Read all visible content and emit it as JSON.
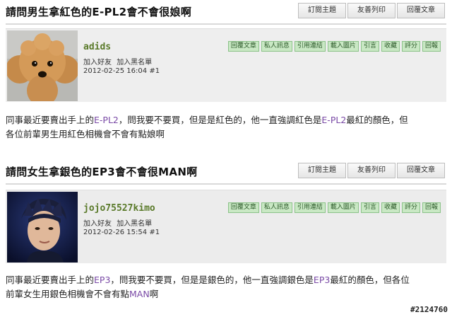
{
  "posts": [
    {
      "thread_title": "請問男生拿紅色的E-PL2會不會很娘啊",
      "toolbar": [
        "訂閱主題",
        "友善列印",
        "回覆文章"
      ],
      "user": {
        "name": "adids",
        "links": [
          "加入好友",
          "加入黑名單"
        ],
        "date": "2012-02-25 16:04",
        "floor": "#1"
      },
      "actions": [
        "回覆文章",
        "私人訊息",
        "引用連結",
        "載入圖片",
        "引言",
        "收藏",
        "評分",
        "回報"
      ],
      "body": [
        {
          "t": "同事最近要賣出手上的"
        },
        {
          "t": "E-PL2",
          "hl": true
        },
        {
          "t": "，問我要不要買，但是是紅色的，他一直強調紅色是"
        },
        {
          "t": "E-PL2",
          "hl": true
        },
        {
          "t": "最紅的顏色，但"
        },
        {
          "br": true
        },
        {
          "t": "各位前輩男生用紅色相機會不會有點娘啊"
        }
      ]
    },
    {
      "thread_title": "請問女生拿銀色的EP3會不會很MAN啊",
      "toolbar": [
        "訂閱主題",
        "友善列印",
        "回覆文章"
      ],
      "user": {
        "name": "jojo75527kimo",
        "links": [
          "加入好友",
          "加入黑名單"
        ],
        "date": "2012-02-26 15:54",
        "floor": "#1"
      },
      "actions": [
        "回覆文章",
        "私人訊息",
        "引用連結",
        "載入圖片",
        "引言",
        "收藏",
        "評分",
        "回報"
      ],
      "body": [
        {
          "t": "同事最近要賣出手上的"
        },
        {
          "t": "EP3",
          "hl": true
        },
        {
          "t": "，問我要不要買，但是是銀色的，他一直強調銀色是"
        },
        {
          "t": "EP3",
          "hl": true
        },
        {
          "t": "最紅的顏色，但各位"
        },
        {
          "br": true
        },
        {
          "t": "前輩女生用銀色相機會不會有點"
        },
        {
          "t": "MAN",
          "hl": true
        },
        {
          "t": "啊"
        }
      ]
    }
  ],
  "watermark": "#2124760",
  "colors": {
    "username": "#5a7a2a",
    "action_button_bg": "#c9e8c4",
    "highlight_text": "#7a4aa6"
  }
}
